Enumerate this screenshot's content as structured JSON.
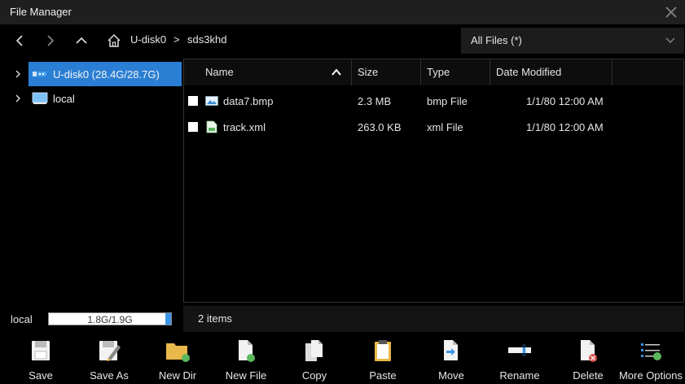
{
  "window": {
    "title": "File Manager"
  },
  "nav": {
    "breadcrumb": [
      "U-disk0",
      "sds3khd"
    ],
    "separator": ">",
    "filter": "All Files (*)"
  },
  "tree": [
    {
      "label": "U-disk0  (28.4G/28.7G)",
      "selected": true,
      "icon": "usb-drive-icon"
    },
    {
      "label": "local",
      "selected": false,
      "icon": "monitor-icon"
    }
  ],
  "columns": {
    "name": "Name",
    "size": "Size",
    "type": "Type",
    "date": "Date Modified"
  },
  "files": [
    {
      "name": "data7.bmp",
      "size": "2.3 MB",
      "type": "bmp File",
      "date": "1/1/80 12:00 AM",
      "icon": "image-file-icon"
    },
    {
      "name": "track.xml",
      "size": "263.0 KB",
      "type": "xml File",
      "date": "1/1/80 12:00 AM",
      "icon": "xml-file-icon"
    }
  ],
  "storage": {
    "label": "local",
    "value": "1.8G/1.9G",
    "used_fraction": 0.05
  },
  "status": {
    "items": "2 items"
  },
  "toolbar": [
    {
      "label": "Save",
      "icon": "save-icon"
    },
    {
      "label": "Save As",
      "icon": "save-as-icon"
    },
    {
      "label": "New Dir",
      "icon": "new-dir-icon"
    },
    {
      "label": "New File",
      "icon": "new-file-icon"
    },
    {
      "label": "Copy",
      "icon": "copy-icon"
    },
    {
      "label": "Paste",
      "icon": "paste-icon"
    },
    {
      "label": "Move",
      "icon": "move-icon"
    },
    {
      "label": "Rename",
      "icon": "rename-icon"
    },
    {
      "label": "Delete",
      "icon": "delete-icon"
    },
    {
      "label": "More Options",
      "icon": "more-options-icon"
    }
  ],
  "colors": {
    "accent": "#2a7fd4",
    "green": "#5cb85c",
    "red": "#d9534f",
    "folder": "#e8b84a"
  }
}
